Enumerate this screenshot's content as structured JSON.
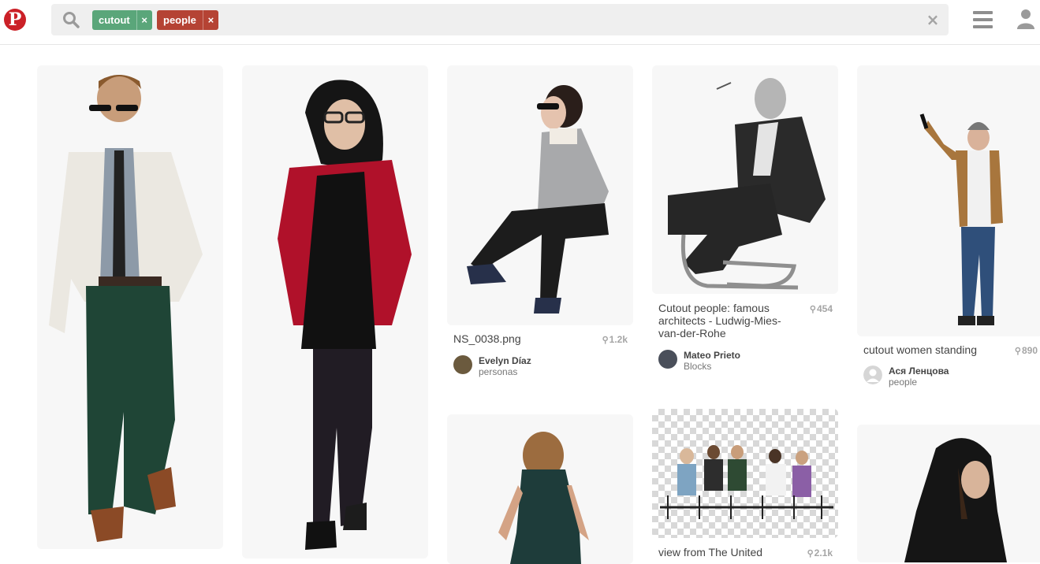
{
  "header": {
    "logo": "P",
    "search": {
      "chips": [
        {
          "label": "cutout",
          "color": "#5aa67a"
        },
        {
          "label": "people",
          "color": "#b54334"
        }
      ],
      "chip_close": "×",
      "clear": "×"
    },
    "icons": [
      "pinterest-logo",
      "search-icon",
      "clear-search-icon",
      "menu-icon",
      "user-icon"
    ]
  },
  "pins": [
    {
      "title": "",
      "count": ""
    },
    {
      "title": "",
      "count": ""
    },
    {
      "title": "NS_0038.png",
      "count": "1.2k",
      "pinner": "Evelyn Díaz",
      "board": "personas"
    },
    {
      "title": "Cutout people: famous architects - Ludwig-Mies-van-der-Rohe",
      "count": "454",
      "pinner": "Mateo Prieto",
      "board": "Blocks"
    },
    {
      "title": "cutout women standing",
      "count": "890",
      "pinner": "Ася Ленцова",
      "board": "people"
    },
    {
      "title": "",
      "count": ""
    },
    {
      "title": "view from The United",
      "count": "2.1k"
    },
    {
      "title": "",
      "count": ""
    }
  ],
  "pin_glyph": "⚲"
}
